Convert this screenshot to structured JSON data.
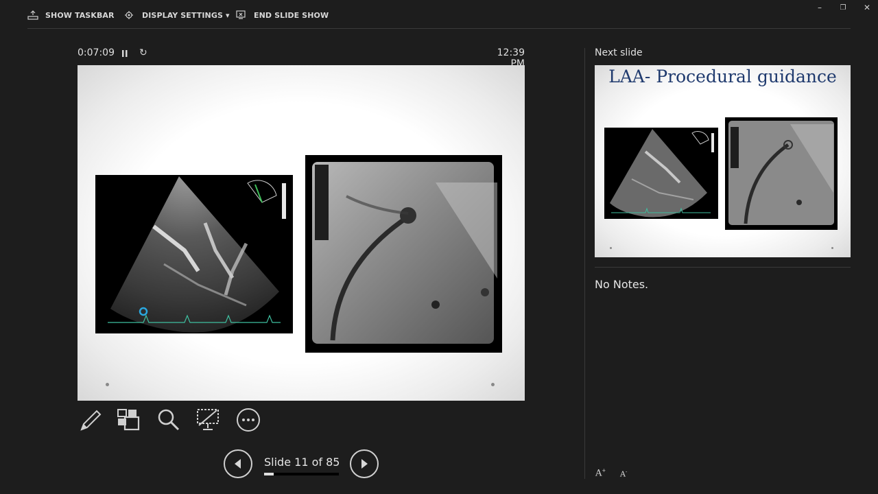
{
  "toolbar": {
    "show_taskbar": "SHOW TASKBAR",
    "display_settings": "DISPLAY SETTINGS ▾",
    "end_slide_show": "END SLIDE SHOW"
  },
  "presenter": {
    "timer": "0:07:09",
    "clock": "12:39 PM",
    "slide_counter": "Slide 11 of 85",
    "progress_fraction": 0.129
  },
  "tools": [
    "pen-icon",
    "slides-grid-icon",
    "zoom-icon",
    "black-screen-icon",
    "more-options-icon"
  ],
  "next": {
    "label": "Next slide",
    "title": "LAA- Procedural guidance"
  },
  "notes": {
    "text": "No Notes."
  },
  "colors": {
    "background": "#1d1d1d",
    "next_title": "#1f3a6e",
    "echo_trace": "#3fbfa0",
    "marker": "#2aa8e0"
  }
}
